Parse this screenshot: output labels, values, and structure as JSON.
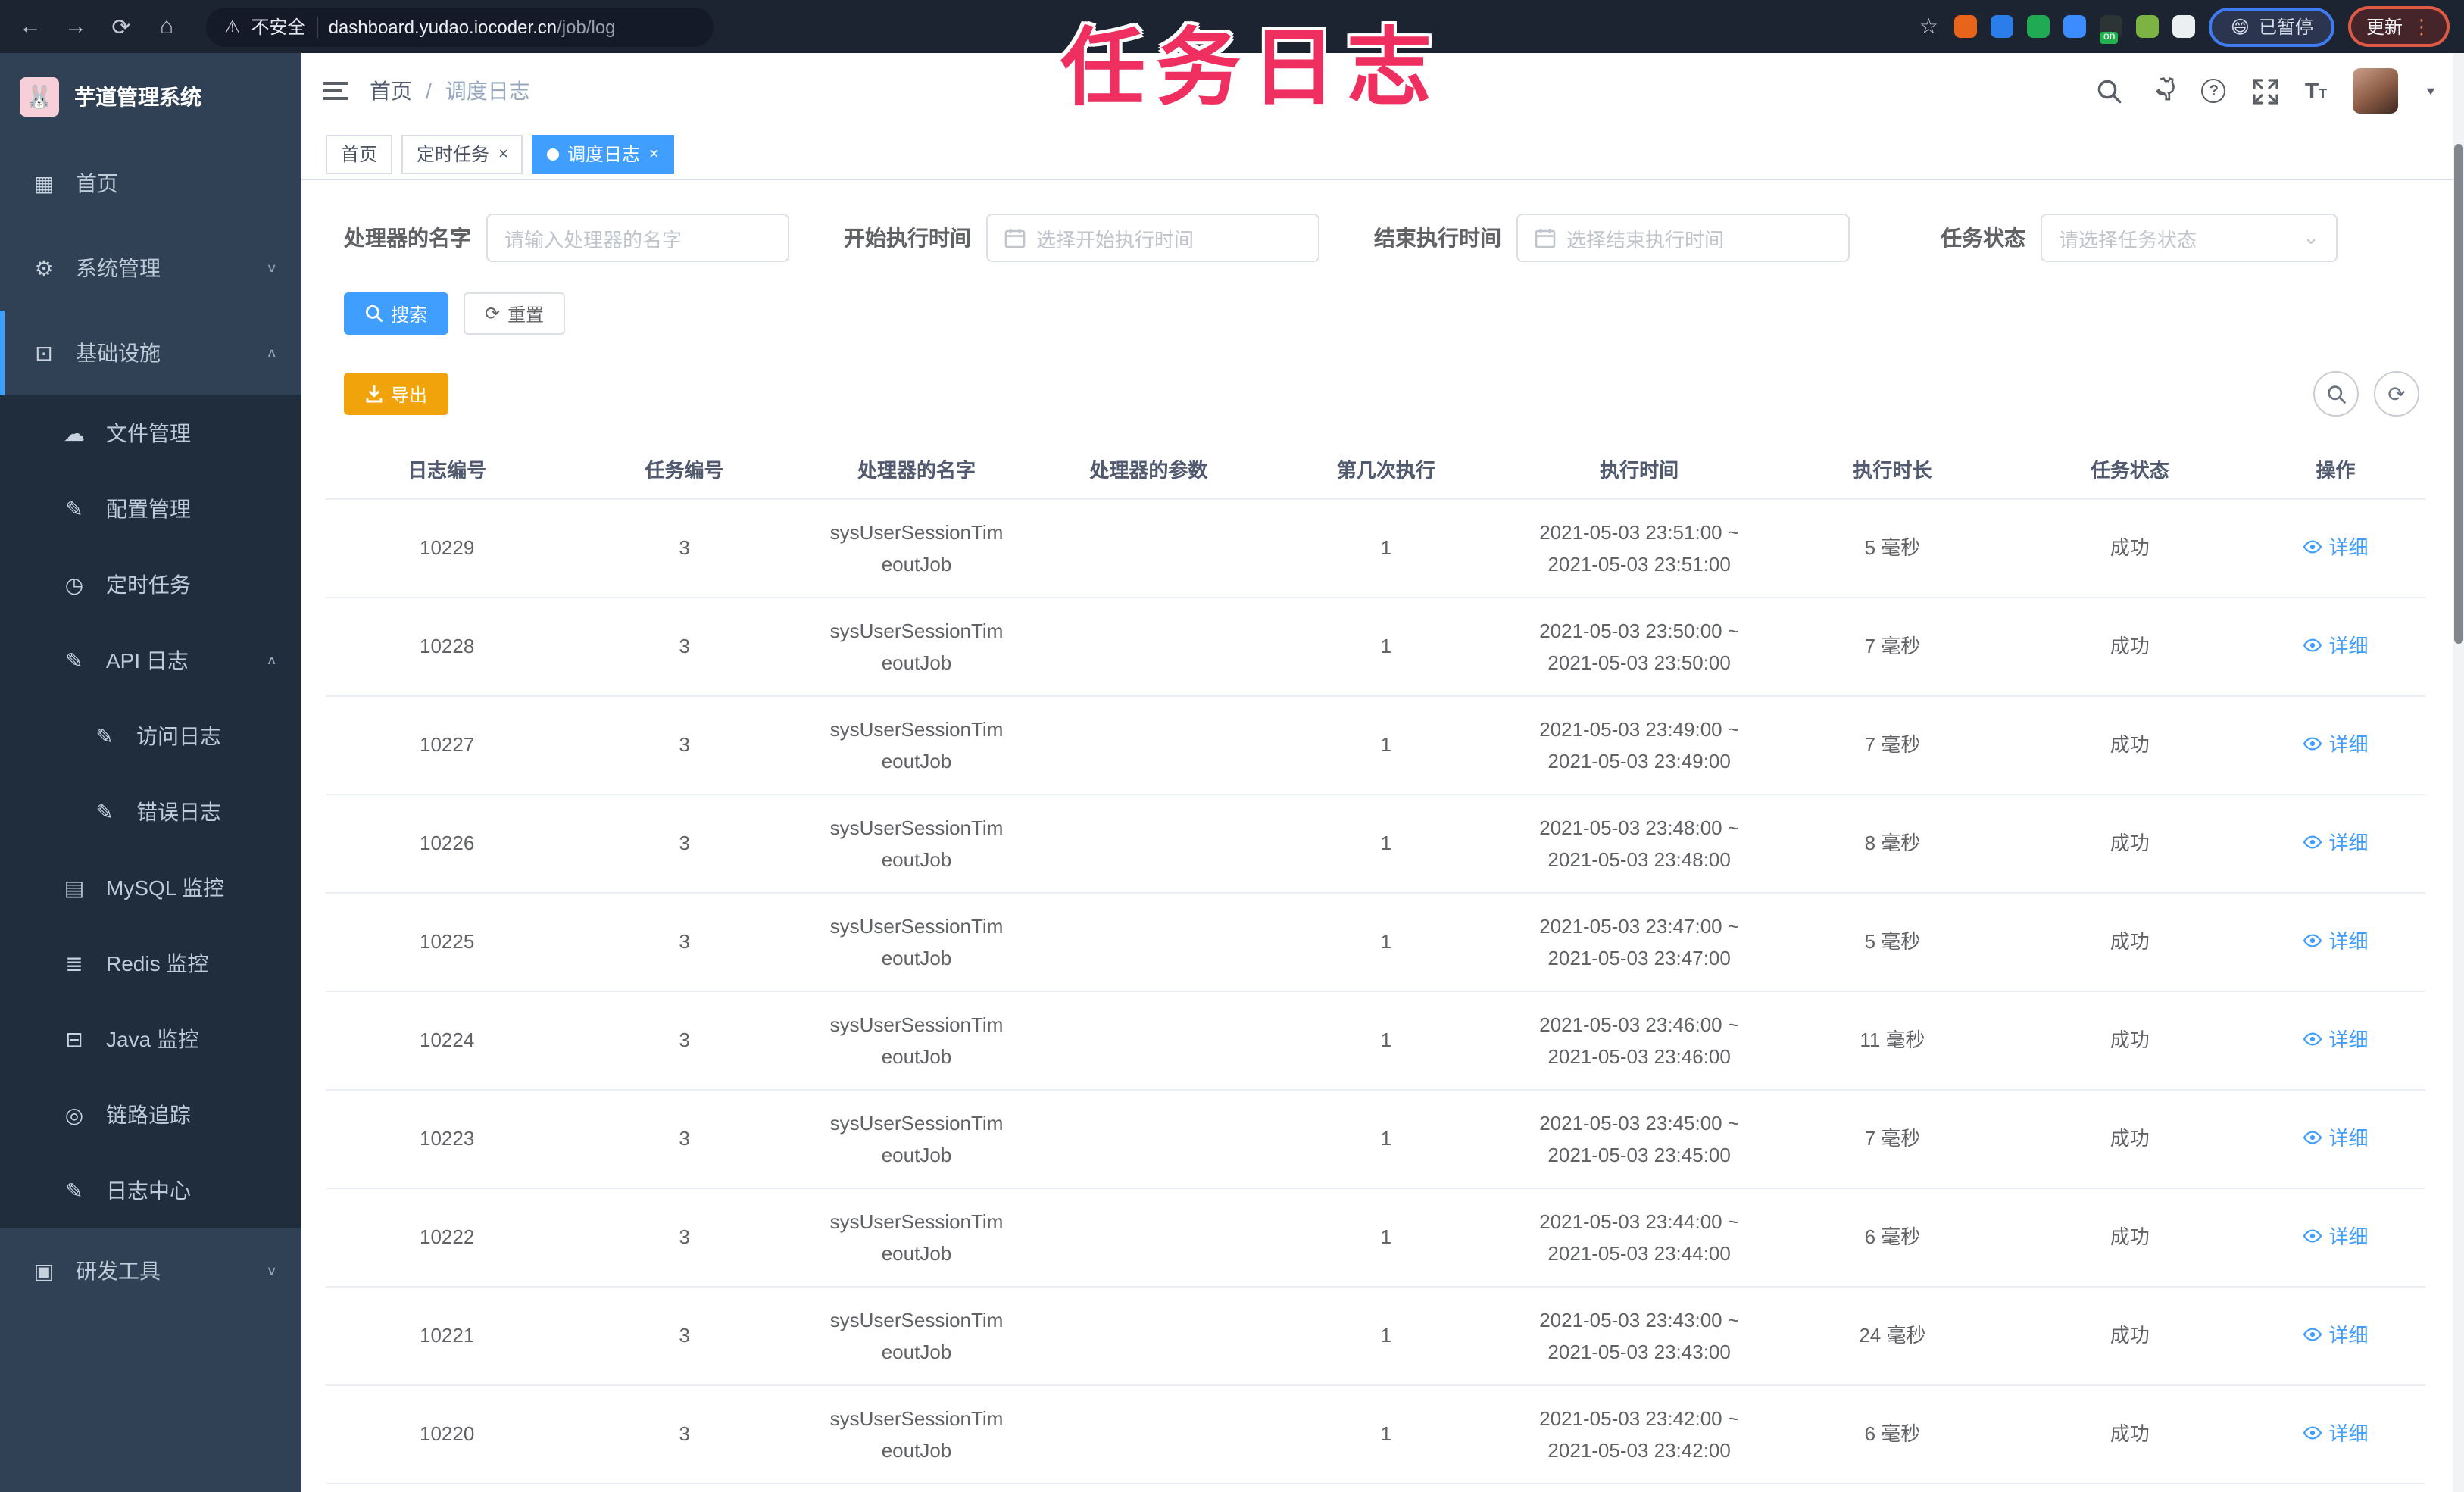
{
  "colors": {
    "accent": "#409eff",
    "warning": "#f0a30a",
    "annotation": "#ee2f5f",
    "sidebar_bg": "#304156",
    "submenu_bg": "#1f2d3d",
    "profile_ring": "#3f7bf0",
    "update_ring": "#df5a45"
  },
  "annotation": {
    "text": "任务日志"
  },
  "browser": {
    "security_label": "不安全",
    "url_host": "dashboard.yudao.iocoder.cn",
    "url_path": "/job/log",
    "profile_label": "已暂停",
    "profile_emoji": "😄",
    "update_label": "更新",
    "extensions": [
      {
        "name": "extension-orange-ring-icon",
        "color": "#e8641b",
        "badge": ""
      },
      {
        "name": "extension-blue-drop-icon",
        "color": "#2b7de9",
        "badge": ""
      },
      {
        "name": "extension-green-circle-icon",
        "color": "#1faa53",
        "badge": ""
      },
      {
        "name": "extension-blue-grid-icon",
        "color": "#3c8cff",
        "badge": ""
      },
      {
        "name": "extension-on-badge-icon",
        "color": "#2d3436",
        "badge": "on"
      },
      {
        "name": "extension-green-leaf-icon",
        "color": "#7cb342",
        "badge": ""
      },
      {
        "name": "extension-paw-icon",
        "color": "#eceff1",
        "badge": ""
      }
    ]
  },
  "sidebar": {
    "app_title": "芋道管理系统",
    "items": [
      {
        "label": "首页",
        "icon": "dashboard-icon",
        "level": "top",
        "chevron": "",
        "active": false
      },
      {
        "label": "系统管理",
        "icon": "gear-icon",
        "level": "top",
        "chevron": "down",
        "active": false
      },
      {
        "label": "基础设施",
        "icon": "monitor-icon",
        "level": "top",
        "chevron": "up",
        "active": true
      },
      {
        "label": "文件管理",
        "icon": "cloud-upload-icon",
        "level": "sub",
        "chevron": "",
        "active": false
      },
      {
        "label": "配置管理",
        "icon": "config-edit-icon",
        "level": "sub",
        "chevron": "",
        "active": false
      },
      {
        "label": "定时任务",
        "icon": "schedule-icon",
        "level": "sub",
        "chevron": "",
        "active": false
      },
      {
        "label": "API 日志",
        "icon": "api-log-icon",
        "level": "sub",
        "chevron": "up",
        "active": false
      },
      {
        "label": "访问日志",
        "icon": "access-log-icon",
        "level": "sub2",
        "chevron": "",
        "active": false
      },
      {
        "label": "错误日志",
        "icon": "error-log-icon",
        "level": "sub2",
        "chevron": "",
        "active": false
      },
      {
        "label": "MySQL 监控",
        "icon": "mysql-monitor-icon",
        "level": "sub",
        "chevron": "",
        "active": false
      },
      {
        "label": "Redis 监控",
        "icon": "redis-monitor-icon",
        "level": "sub",
        "chevron": "",
        "active": false
      },
      {
        "label": "Java 监控",
        "icon": "java-monitor-icon",
        "level": "sub",
        "chevron": "",
        "active": false
      },
      {
        "label": "链路追踪",
        "icon": "trace-icon",
        "level": "sub",
        "chevron": "",
        "active": false
      },
      {
        "label": "日志中心",
        "icon": "log-center-icon",
        "level": "sub",
        "chevron": "",
        "active": false
      },
      {
        "label": "研发工具",
        "icon": "toolbox-icon",
        "level": "top",
        "chevron": "down",
        "active": false
      }
    ]
  },
  "header": {
    "breadcrumb_home": "首页",
    "breadcrumb_sep": "/",
    "breadcrumb_current": "调度日志"
  },
  "tabs": [
    {
      "label": "首页",
      "active": false,
      "closable": false
    },
    {
      "label": "定时任务",
      "active": false,
      "closable": true
    },
    {
      "label": "调度日志",
      "active": true,
      "closable": true
    }
  ],
  "filters": {
    "handler_label": "处理器的名字",
    "handler_placeholder": "请输入处理器的名字",
    "start_label": "开始执行时间",
    "start_placeholder": "选择开始执行时间",
    "end_label": "结束执行时间",
    "end_placeholder": "选择结束执行时间",
    "status_label": "任务状态",
    "status_placeholder": "请选择任务状态"
  },
  "toolbar": {
    "search_label": "搜索",
    "reset_label": "重置",
    "export_label": "导出"
  },
  "table": {
    "columns": [
      "日志编号",
      "任务编号",
      "处理器的名字",
      "处理器的参数",
      "第几次执行",
      "执行时间",
      "执行时长",
      "任务状态",
      "操作"
    ],
    "action_label": "详细",
    "rows": [
      {
        "id": "10229",
        "task_id": "3",
        "handler_line1": "sysUserSessionTim",
        "handler_line2": "eoutJob",
        "param": "",
        "count": "1",
        "time1": "2021-05-03 23:51:00 ~",
        "time2": "2021-05-03 23:51:00",
        "duration": "5 毫秒",
        "status": "成功"
      },
      {
        "id": "10228",
        "task_id": "3",
        "handler_line1": "sysUserSessionTim",
        "handler_line2": "eoutJob",
        "param": "",
        "count": "1",
        "time1": "2021-05-03 23:50:00 ~",
        "time2": "2021-05-03 23:50:00",
        "duration": "7 毫秒",
        "status": "成功"
      },
      {
        "id": "10227",
        "task_id": "3",
        "handler_line1": "sysUserSessionTim",
        "handler_line2": "eoutJob",
        "param": "",
        "count": "1",
        "time1": "2021-05-03 23:49:00 ~",
        "time2": "2021-05-03 23:49:00",
        "duration": "7 毫秒",
        "status": "成功"
      },
      {
        "id": "10226",
        "task_id": "3",
        "handler_line1": "sysUserSessionTim",
        "handler_line2": "eoutJob",
        "param": "",
        "count": "1",
        "time1": "2021-05-03 23:48:00 ~",
        "time2": "2021-05-03 23:48:00",
        "duration": "8 毫秒",
        "status": "成功"
      },
      {
        "id": "10225",
        "task_id": "3",
        "handler_line1": "sysUserSessionTim",
        "handler_line2": "eoutJob",
        "param": "",
        "count": "1",
        "time1": "2021-05-03 23:47:00 ~",
        "time2": "2021-05-03 23:47:00",
        "duration": "5 毫秒",
        "status": "成功"
      },
      {
        "id": "10224",
        "task_id": "3",
        "handler_line1": "sysUserSessionTim",
        "handler_line2": "eoutJob",
        "param": "",
        "count": "1",
        "time1": "2021-05-03 23:46:00 ~",
        "time2": "2021-05-03 23:46:00",
        "duration": "11 毫秒",
        "status": "成功"
      },
      {
        "id": "10223",
        "task_id": "3",
        "handler_line1": "sysUserSessionTim",
        "handler_line2": "eoutJob",
        "param": "",
        "count": "1",
        "time1": "2021-05-03 23:45:00 ~",
        "time2": "2021-05-03 23:45:00",
        "duration": "7 毫秒",
        "status": "成功"
      },
      {
        "id": "10222",
        "task_id": "3",
        "handler_line1": "sysUserSessionTim",
        "handler_line2": "eoutJob",
        "param": "",
        "count": "1",
        "time1": "2021-05-03 23:44:00 ~",
        "time2": "2021-05-03 23:44:00",
        "duration": "6 毫秒",
        "status": "成功"
      },
      {
        "id": "10221",
        "task_id": "3",
        "handler_line1": "sysUserSessionTim",
        "handler_line2": "eoutJob",
        "param": "",
        "count": "1",
        "time1": "2021-05-03 23:43:00 ~",
        "time2": "2021-05-03 23:43:00",
        "duration": "24 毫秒",
        "status": "成功"
      },
      {
        "id": "10220",
        "task_id": "3",
        "handler_line1": "sysUserSessionTim",
        "handler_line2": "eoutJob",
        "param": "",
        "count": "1",
        "time1": "2021-05-03 23:42:00 ~",
        "time2": "2021-05-03 23:42:00",
        "duration": "6 毫秒",
        "status": "成功"
      }
    ]
  }
}
